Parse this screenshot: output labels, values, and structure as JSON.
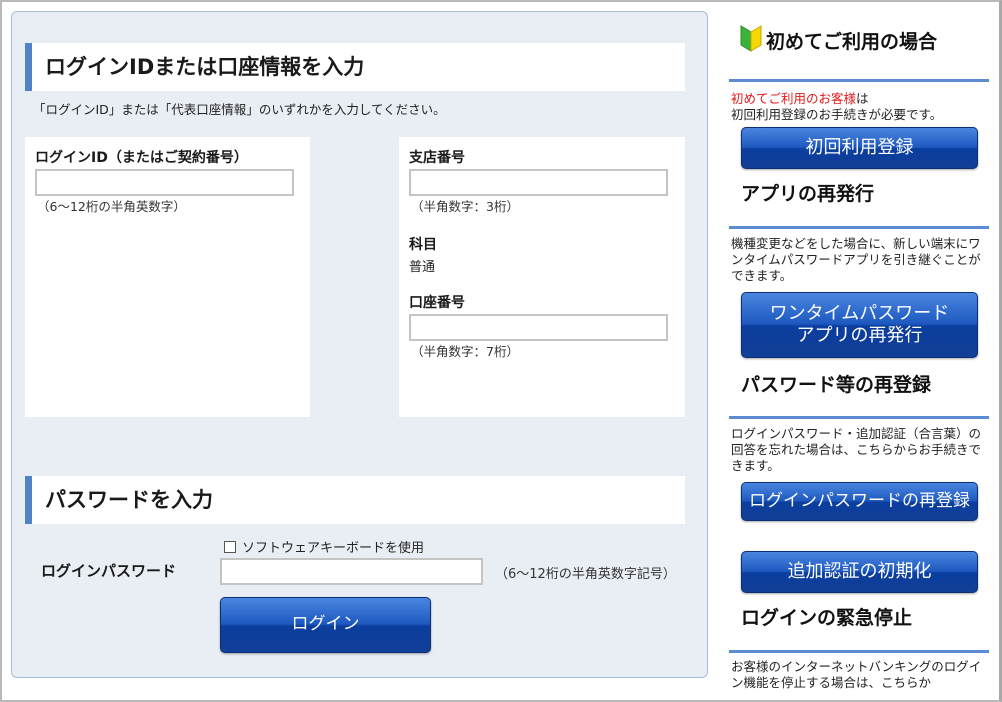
{
  "login_section": {
    "title": "ログインIDまたは口座情報を入力",
    "note": "「ログインID」または「代表口座情報」のいずれかを入力してください。",
    "login_id": {
      "label": "ログインID（またはご契約番号）",
      "value": "",
      "hint": "（6～12桁の半角英数字）"
    },
    "branch": {
      "label": "支店番号",
      "value": "",
      "hint": "（半角数字：3桁）"
    },
    "subject": {
      "label": "科目",
      "value": "普通"
    },
    "account": {
      "label": "口座番号",
      "value": "",
      "hint": "（半角数字：7桁）"
    }
  },
  "password_section": {
    "title": "パスワードを入力",
    "password_label": "ログインパスワード",
    "software_keyboard_label": "ソフトウェアキーボードを使用",
    "software_keyboard_checked": false,
    "password_value": "",
    "password_hint": "（6～12桁の半角英数字記号）",
    "login_button": "ログイン"
  },
  "sidebar": {
    "first_use": {
      "title": "初めてご利用の場合",
      "icon": "beginner-mark-icon",
      "text_red": "初めてご利用のお客様",
      "text_after_red": "は",
      "text_line2": "初回利用登録のお手続きが必要です。",
      "button": "初回利用登録"
    },
    "app_reissue": {
      "title": "アプリの再発行",
      "text": "機種変更などをした場合に、新しい端末にワンタイムパスワードアプリを引き継ぐことができます。",
      "button_line1": "ワンタイムパスワード",
      "button_line2": "アプリの再発行"
    },
    "password_reregister": {
      "title": "パスワード等の再登録",
      "text": "ログインパスワード・追加認証（合言葉）の回答を忘れた場合は、こちらからお手続きできます。",
      "button1": "ログインパスワードの再登録",
      "button2": "追加認証の初期化"
    },
    "emergency_stop": {
      "title": "ログインの緊急停止",
      "text": "お客様のインターネットバンキングのログイン機能を停止する場合は、こちらか"
    }
  },
  "colors": {
    "accent_bar": "#4f82c6",
    "panel_bg": "#e9eef5",
    "button_blue": "#1e59c0",
    "notice_red": "#e01818"
  }
}
